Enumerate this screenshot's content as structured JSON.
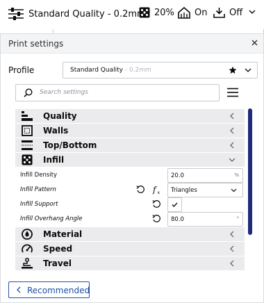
{
  "topbar": {
    "profile_summary": "Standard Quality - 0.2mm",
    "infill_value": "20%",
    "support_value": "On",
    "adhesion_value": "Off",
    "icons": [
      "settings-sliders-icon",
      "infill-icon",
      "support-icon",
      "adhesion-icon",
      "chevron-down-icon"
    ]
  },
  "panel": {
    "title": "Print settings",
    "profile_label": "Profile",
    "profile_name": "Standard Quality",
    "profile_sub": " - 0.2mm",
    "search_placeholder": "Search settings",
    "recommended_label": "Recommended"
  },
  "categories": {
    "quality": "Quality",
    "walls": "Walls",
    "top_bottom": "Top/Bottom",
    "infill": "Infill",
    "material": "Material",
    "speed": "Speed",
    "travel": "Travel"
  },
  "settings": {
    "infill_density": {
      "label": "Infill Density",
      "value": "20.0",
      "unit": "%"
    },
    "infill_pattern": {
      "label": "Infill Pattern",
      "value": "Triangles"
    },
    "infill_support": {
      "label": "Infill Support",
      "checked": true
    },
    "infill_overhang": {
      "label": "Infill Overhang Angle",
      "value": "80.0",
      "unit": "°"
    }
  },
  "colors": {
    "accent": "#1d4fa6",
    "scrollbar": "#1f2a7d",
    "category_bg": "#ebebee",
    "header_bg": "#f3f4f6"
  }
}
